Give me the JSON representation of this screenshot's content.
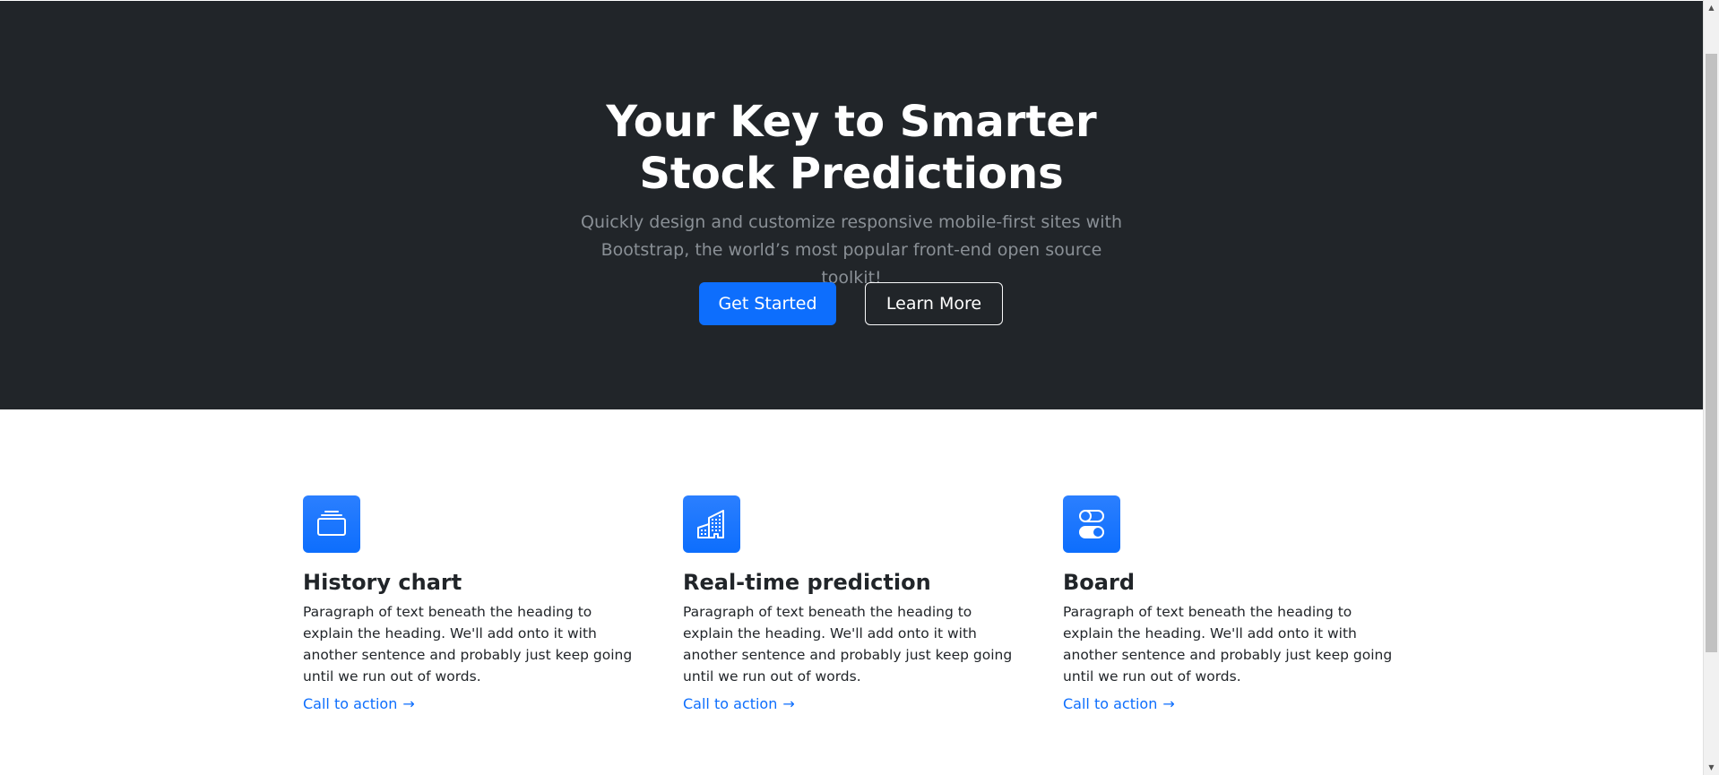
{
  "hero": {
    "title_line1": "Your Key to Smarter",
    "title_line2": "Stock Predictions",
    "lead": "Quickly design and customize responsive mobile-first sites with Bootstrap, the world’s most popular front-end open source toolkit!",
    "primary_button": "Get Started",
    "secondary_button": "Learn More"
  },
  "colors": {
    "hero_background": "#212529",
    "accent": "#0d6efd",
    "body_text": "#212529",
    "muted_text": "#8a9096"
  },
  "features": [
    {
      "icon": "collection-icon",
      "title": "History chart",
      "text": "Paragraph of text beneath the heading to explain the heading. We'll add onto it with another sentence and probably just keep going until we run out of words.",
      "link": "Call to action",
      "link_arrow": "→"
    },
    {
      "icon": "building-icon",
      "title": "Real-time prediction",
      "text": "Paragraph of text beneath the heading to explain the heading. We'll add onto it with another sentence and probably just keep going until we run out of words.",
      "link": "Call to action",
      "link_arrow": "→"
    },
    {
      "icon": "toggles-icon",
      "title": "Board",
      "text": "Paragraph of text beneath the heading to explain the heading. We'll add onto it with another sentence and probably just keep going until we run out of words.",
      "link": "Call to action",
      "link_arrow": "→"
    }
  ],
  "scrollbar": {
    "up_arrow": "▲",
    "down_arrow": "▼"
  }
}
